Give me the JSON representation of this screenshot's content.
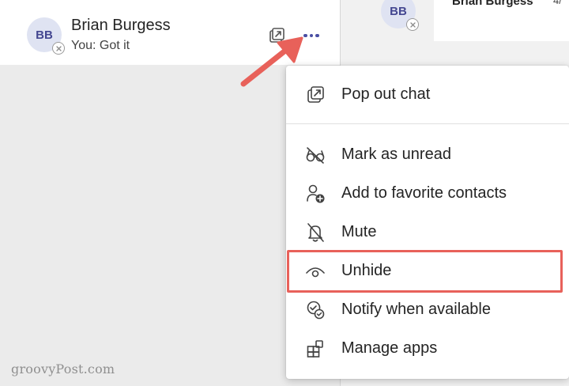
{
  "chat_list": {
    "item": {
      "initials": "BB",
      "name": "Brian Burgess",
      "preview": "You: Got it",
      "actions": {
        "popout_icon": "popout-icon",
        "more_icon": "more-options-icon"
      }
    }
  },
  "conversation_header": {
    "initials": "BB",
    "name": "Brian Burgess",
    "tag": "4/"
  },
  "context_menu": {
    "items": [
      {
        "label": "Pop out chat",
        "icon": "popout-icon"
      },
      {
        "label": "Mark as unread",
        "icon": "glasses-icon"
      },
      {
        "label": "Add to favorite contacts",
        "icon": "person-add-icon"
      },
      {
        "label": "Mute",
        "icon": "bell-off-icon"
      },
      {
        "label": "Unhide",
        "icon": "eye-icon"
      },
      {
        "label": "Notify when available",
        "icon": "notify-icon"
      },
      {
        "label": "Manage apps",
        "icon": "apps-icon"
      }
    ],
    "highlighted_item": "Unhide"
  },
  "annotation": {
    "arrow_color": "#e8615a",
    "highlight_color": "#e8615a"
  },
  "watermark": "groovyPost.com"
}
